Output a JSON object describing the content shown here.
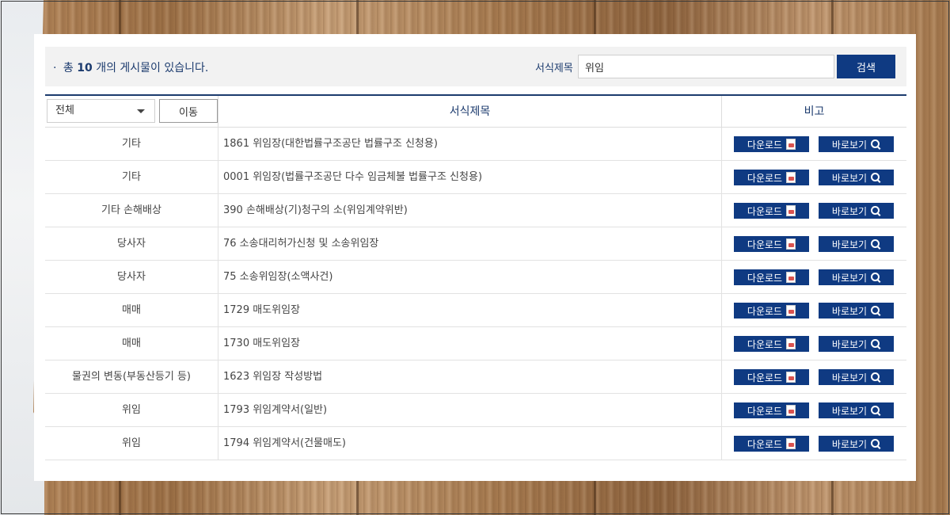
{
  "summary": {
    "bullet": "·",
    "prefix": "총",
    "count": "10",
    "suffix": "개의 게시물이 있습니다."
  },
  "search": {
    "label": "서식제목",
    "value": "위임",
    "button_label": "검색"
  },
  "filter": {
    "selected": "전체",
    "move_label": "이동"
  },
  "table": {
    "header_title": "서식제목",
    "header_note": "비고",
    "download_label": "다운로드",
    "view_label": "바로보기",
    "rows": [
      {
        "category": "기타",
        "title": "1861 위임장(대한법률구조공단 법률구조 신청용)"
      },
      {
        "category": "기타",
        "title": "0001 위임장(법률구조공단 다수 임금체불 법률구조 신청용)"
      },
      {
        "category": "기타 손해배상",
        "title": "390 손해배상(기)청구의 소(위임계약위반)"
      },
      {
        "category": "당사자",
        "title": "76 소송대리허가신청 및 소송위임장"
      },
      {
        "category": "당사자",
        "title": "75 소송위임장(소액사건)"
      },
      {
        "category": "매매",
        "title": "1729 매도위임장"
      },
      {
        "category": "매매",
        "title": "1730 매도위임장"
      },
      {
        "category": "물권의 변동(부동산등기 등)",
        "title": "1623 위임장 작성방법"
      },
      {
        "category": "위임",
        "title": "1793 위임계약서(일반)"
      },
      {
        "category": "위임",
        "title": "1794 위임계약서(건물매도)"
      }
    ]
  },
  "colors": {
    "accent": "#0f3a82",
    "heading": "#1c3b6e",
    "topbar_bg": "#f2f2f2"
  }
}
